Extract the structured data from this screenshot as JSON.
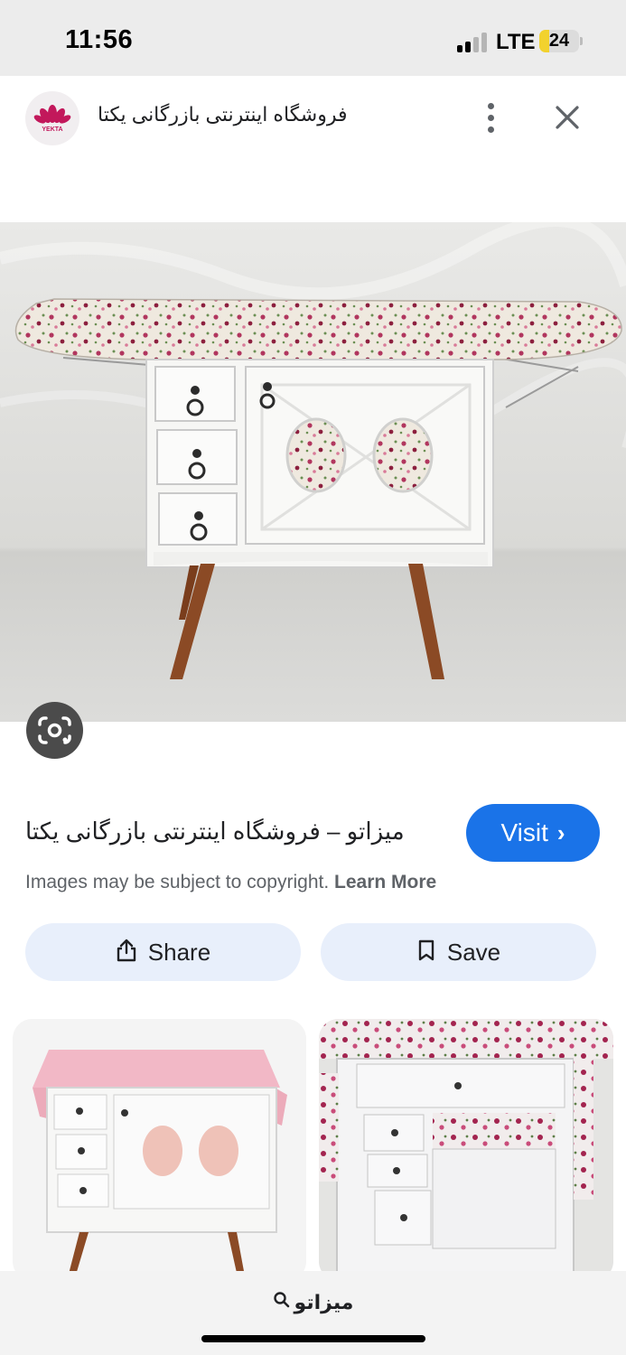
{
  "status_bar": {
    "time": "11:56",
    "network": "LTE",
    "battery_level": "24",
    "battery_fraction": 0.24
  },
  "header": {
    "site_title": "فروشگاه اینترنتی بازرگانی یکتا",
    "logo_text": "YEKTA",
    "logo_icon": "lotus-logo-icon",
    "more_icon": "more-vertical-icon",
    "close_icon": "close-icon"
  },
  "main_image": {
    "subject": "ironing-board-cabinet",
    "lens_icon": "google-lens-icon"
  },
  "result": {
    "title": "میزاتو – فروشگاه اینترنتی بازرگانی یکتا",
    "visit_label": "Visit",
    "visit_icon": "chevron-right-icon",
    "copyright_text": "Images may be subject to copyright.",
    "learn_more_label": "Learn More"
  },
  "actions": {
    "share_label": "Share",
    "share_icon": "share-icon",
    "save_label": "Save",
    "save_icon": "bookmark-icon"
  },
  "related": [
    {
      "subject": "pink-top-cabinet"
    },
    {
      "subject": "floral-ironing-cabinet"
    }
  ],
  "bottom_bar": {
    "search_query": "میزاتو",
    "search_icon": "search-icon"
  },
  "colors": {
    "accent": "#1a73e8",
    "action_bg": "#e8effb",
    "status_bg": "#ececec",
    "battery": "#f2d22e",
    "logo_red": "#c2185b"
  }
}
